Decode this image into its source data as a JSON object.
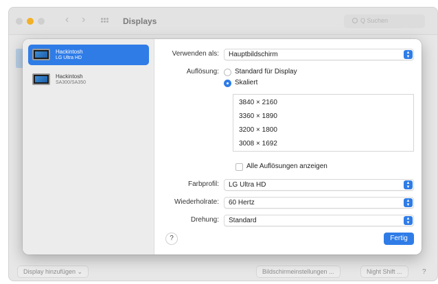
{
  "window": {
    "title": "Displays",
    "search_placeholder": "Q Suchen"
  },
  "bottom": {
    "add_display": "Display hinzufügen ⌄",
    "screen_settings": "Bildschirmeinstellungen ...",
    "night_shift": "Night Shift ...",
    "help": "?"
  },
  "sidebar": {
    "items": [
      {
        "name": "Hackintosh",
        "subtitle": "LG Ultra HD",
        "selected": true
      },
      {
        "name": "Hackintosh",
        "subtitle": "SA300/SA350",
        "selected": false
      }
    ]
  },
  "settings": {
    "use_as_label": "Verwenden als:",
    "use_as_value": "Hauptbildschirm",
    "resolution_label": "Auflösung:",
    "resolution_options": [
      {
        "label": "Standard für Display",
        "selected": false
      },
      {
        "label": "Skaliert",
        "selected": true
      }
    ],
    "resolutions": [
      "3840 × 2160",
      "3360 × 1890",
      "3200 × 1800",
      "3008 × 1692"
    ],
    "show_all_label": "Alle Auflösungen anzeigen",
    "show_all_checked": false,
    "color_profile_label": "Farbprofil:",
    "color_profile_value": "LG Ultra HD",
    "refresh_label": "Wiederholrate:",
    "refresh_value": "60 Hertz",
    "rotation_label": "Drehung:",
    "rotation_value": "Standard"
  },
  "footer": {
    "help": "?",
    "done": "Fertig"
  },
  "colors": {
    "accent": "#2f7ce7",
    "traffic_yellow": "#f2b027"
  }
}
